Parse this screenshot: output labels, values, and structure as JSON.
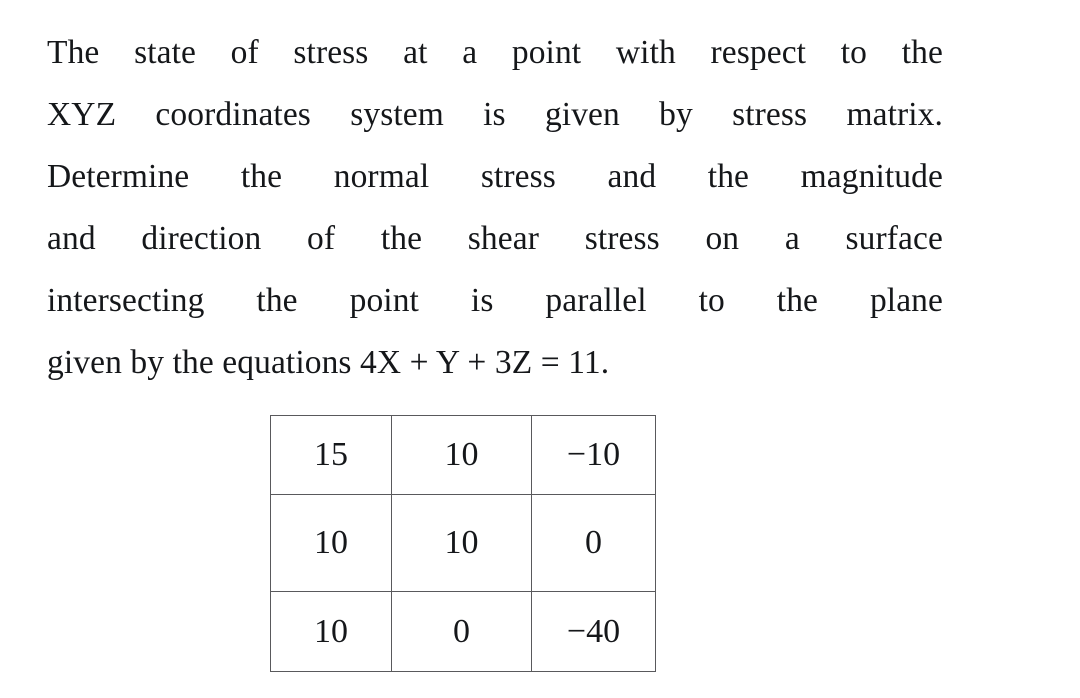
{
  "document": {
    "kind": "textbook-problem",
    "text_color": "#15171a",
    "background_color": "#ffffff",
    "table_border_color": "#59595c"
  },
  "problem": {
    "full_text": "The state of stress at a point with respect to the XYZ coordinates system is given by stress matrix. Determine the normal stress and the magnitude and direction of the shear stress on a surface intersecting the point is parallel to the plane given by the equations 4X + Y + 3Z = 11.",
    "lines": [
      {
        "id": "line-1",
        "justified": true,
        "text": "The state of stress at a point with respect to the",
        "words": [
          "The",
          "state",
          "of",
          "stress",
          "at",
          "a",
          "point",
          "with",
          "respect",
          "to",
          "the"
        ]
      },
      {
        "id": "line-2",
        "justified": true,
        "text": "XYZ coordinates system is given by stress matrix.",
        "words": [
          "XYZ",
          "coordinates",
          "system",
          "is",
          "given",
          "by",
          "stress",
          "matrix."
        ]
      },
      {
        "id": "line-3",
        "justified": true,
        "text": "Determine the normal stress and the magnitude",
        "words": [
          "Determine",
          "the",
          "normal",
          "stress",
          "and",
          "the",
          "magnitude"
        ]
      },
      {
        "id": "line-4",
        "justified": true,
        "text": "and direction of the shear stress on a surface",
        "words": [
          "and",
          "direction",
          "of",
          "the",
          "shear",
          "stress",
          "on",
          "a",
          "surface"
        ]
      },
      {
        "id": "line-5",
        "justified": true,
        "text": "intersecting the point is parallel to the plane",
        "words": [
          "intersecting",
          "the",
          "point",
          "is",
          "parallel",
          "to",
          "the",
          "plane"
        ]
      },
      {
        "id": "line-6",
        "justified": false,
        "text": "given by the equations 4X + Y + 3Z = 11.",
        "words": [
          "given",
          "by",
          "the",
          "equations",
          "4X",
          "+",
          "Y",
          "+",
          "3Z",
          "=",
          "11."
        ]
      }
    ],
    "plane_equation": "4X + Y + 3Z = 11"
  },
  "stress_matrix": {
    "caption": "stress matrix",
    "rows": [
      [
        "15",
        "10",
        "−10"
      ],
      [
        "10",
        "10",
        "0"
      ],
      [
        "10",
        "0",
        "−40"
      ]
    ],
    "numeric_rows": [
      [
        15,
        10,
        -10
      ],
      [
        10,
        10,
        0
      ],
      [
        10,
        0,
        -40
      ]
    ]
  }
}
